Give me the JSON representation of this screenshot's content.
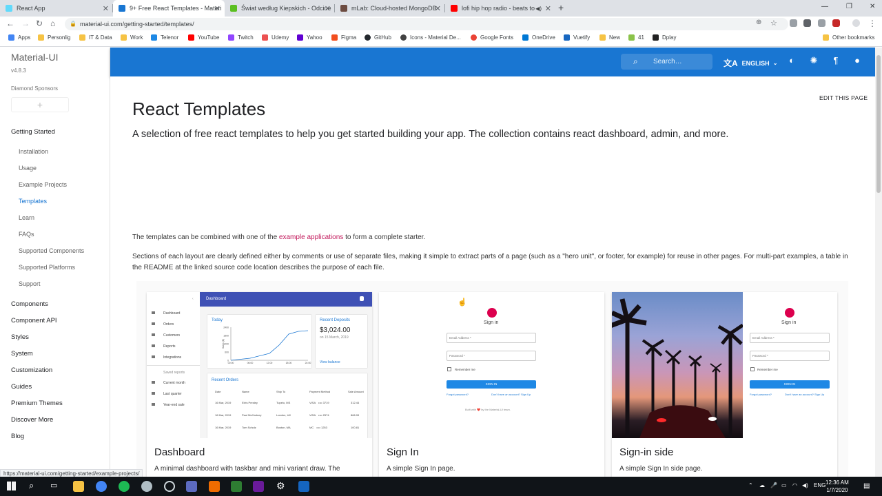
{
  "browser": {
    "tabs": [
      {
        "title": "React App",
        "color": "#61dafb"
      },
      {
        "title": "9+ Free React Templates - Materi",
        "color": "#1976d2"
      },
      {
        "title": "Świat według Kiepskich - Odcine",
        "color": "#5bbf21"
      },
      {
        "title": "mLab: Cloud-hosted MongoDB",
        "color": "#6d4c41"
      },
      {
        "title": "lofi hip hop radio - beats to",
        "color": "#ff0000"
      }
    ],
    "url": "material-ui.com/getting-started/templates/",
    "bookmarks": [
      {
        "label": "Apps",
        "color": "#4285f4"
      },
      {
        "label": "Personlig",
        "color": "#f6c344"
      },
      {
        "label": "IT & Data",
        "color": "#f6c344"
      },
      {
        "label": "Work",
        "color": "#f6c344"
      },
      {
        "label": "Telenor",
        "color": "#1e88e5"
      },
      {
        "label": "YouTube",
        "color": "#ff0000"
      },
      {
        "label": "Twitch",
        "color": "#9146ff"
      },
      {
        "label": "Udemy",
        "color": "#ec5252"
      },
      {
        "label": "Yahoo",
        "color": "#6001d2"
      },
      {
        "label": "Figma",
        "color": "#f24e1e"
      },
      {
        "label": "GitHub",
        "color": "#24292e"
      },
      {
        "label": "Icons - Material De...",
        "color": "#424242"
      },
      {
        "label": "Google Fonts",
        "color": "#ea4335"
      },
      {
        "label": "OneDrive",
        "color": "#0078d4"
      },
      {
        "label": "Vuetify",
        "color": "#1867c0"
      },
      {
        "label": "New",
        "color": "#f6c344"
      },
      {
        "label": "41",
        "color": "#8bc34a"
      },
      {
        "label": "Dplay",
        "color": "#222222"
      }
    ],
    "other_bookmarks": "Other bookmarks",
    "status_url": "https://material-ui.com/getting-started/example-projects/"
  },
  "sidebar": {
    "brand": "Material-UI",
    "version": "v4.8.3",
    "sponsors": "Diamond Sponsors",
    "plus": "+",
    "getting_started": "Getting Started",
    "items": [
      "Installation",
      "Usage",
      "Example Projects",
      "Templates",
      "Learn",
      "FAQs",
      "Supported Components",
      "Supported Platforms",
      "Support"
    ],
    "sections": [
      "Components",
      "Component API",
      "Styles",
      "System",
      "Customization",
      "Guides",
      "Premium Themes",
      "Discover More",
      "Blog"
    ]
  },
  "appbar": {
    "search_placeholder": "Search…",
    "language": "ENGLISH",
    "accent": "#1976d2"
  },
  "page": {
    "edit": "EDIT THIS PAGE",
    "title": "React Templates",
    "lead": "A selection of free react templates to help you get started building your app. The collection contains react dashboard, admin, and more.",
    "p1_before": "The templates can be combined with one of the ",
    "p1_link": "example applications",
    "p1_after": " to form a complete starter.",
    "p2": "Sections of each layout are clearly defined either by comments or use of separate files, making it simple to extract parts of a page (such as a \"hero unit\", or footer, for example) for reuse in other pages. For multi-part examples, a table in the README at the linked source code location describes the purpose of each file."
  },
  "cards": [
    {
      "title": "Dashboard",
      "desc": "A minimal dashboard with taskbar and mini variant draw. The"
    },
    {
      "title": "Sign In",
      "desc": "A simple Sign In page."
    },
    {
      "title": "Sign-in side",
      "desc": "A simple Sign In side page."
    }
  ],
  "preview_dashboard": {
    "title": "Dashboard",
    "menu": [
      "Dashboard",
      "Orders",
      "Customers",
      "Reports",
      "Integrations"
    ],
    "saved": "Saved reports",
    "saved_items": [
      "Current month",
      "Last quarter",
      "Year-end sale"
    ],
    "today": "Today",
    "recent_deposits": "Recent Deposits",
    "amount": "$3,024.00",
    "on_date": "on 15 March, 2019",
    "view_balance": "View balance",
    "recent_orders": "Recent Orders",
    "order_headers": [
      "Date",
      "Name",
      "Ship To",
      "Payment Method",
      "Sale Amount"
    ],
    "orders": [
      [
        "16 Mar, 2019",
        "Elvis Presley",
        "Tupelo, MS",
        "VISA ⠀•••• 3719",
        "312.44"
      ],
      [
        "16 Mar, 2019",
        "Paul McCartney",
        "London, UK",
        "VISA ⠀•••• 2574",
        "866.99"
      ],
      [
        "16 Mar, 2019",
        "Tom Scholz",
        "Boston, MA",
        "MC ⠀•••• 1253",
        "100.81"
      ]
    ],
    "y_ticks": [
      "2400",
      "1800",
      "1200",
      "600",
      "0"
    ],
    "x_ticks": [
      "00:00",
      "03:00",
      "06:00",
      "09:00",
      "12:00",
      "15:00",
      "18:00",
      "21:00",
      "24:00"
    ],
    "y_label": "Sales ($)"
  },
  "preview_signin": {
    "heading": "Sign in",
    "email": "Email Address *",
    "password": "Password *",
    "remember": "Remember me",
    "button": "SIGN IN",
    "forgot": "Forgot password?",
    "signup": "Don't have an account? Sign Up",
    "footer": "Built with ❤️ by the Material-UI team."
  },
  "taskbar": {
    "lang": "ENG",
    "time": "12:36 AM",
    "date": "1/7/2020"
  }
}
